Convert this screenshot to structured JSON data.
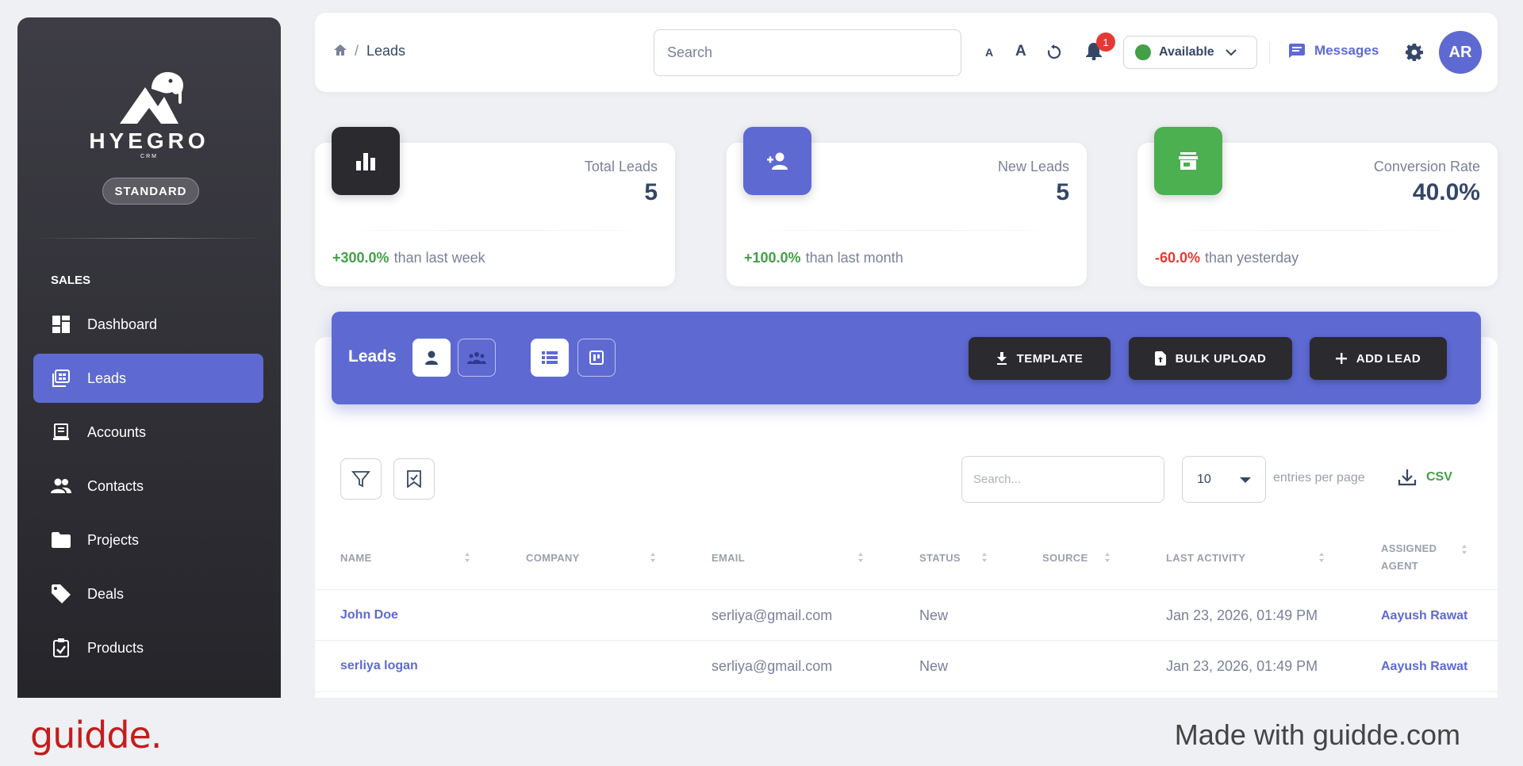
{
  "sidebar": {
    "brand_name": "HYEGRO",
    "brand_sub": "CRM",
    "plan": "STANDARD",
    "section": "SALES",
    "items": [
      {
        "label": "Dashboard",
        "icon": "dashboard-icon"
      },
      {
        "label": "Leads",
        "icon": "leads-icon",
        "active": true
      },
      {
        "label": "Accounts",
        "icon": "accounts-icon"
      },
      {
        "label": "Contacts",
        "icon": "contacts-icon"
      },
      {
        "label": "Projects",
        "icon": "folder-icon"
      },
      {
        "label": "Deals",
        "icon": "tag-icon"
      },
      {
        "label": "Products",
        "icon": "clipboard-icon"
      }
    ]
  },
  "topbar": {
    "breadcrumb_current": "Leads",
    "breadcrumb_sep": "/",
    "search_placeholder": "Search",
    "font_small": "A",
    "font_large": "A",
    "notification_count": "1",
    "status": "Available",
    "messages_label": "Messages",
    "avatar_initials": "AR"
  },
  "stats": [
    {
      "label": "Total Leads",
      "value": "5",
      "change": "+300.0%",
      "period": "than last week",
      "change_color": "#43a047",
      "icon": "bar-chart-icon",
      "icon_bg": "#2a2a2f"
    },
    {
      "label": "New Leads",
      "value": "5",
      "change": "+100.0%",
      "period": "than last month",
      "change_color": "#43a047",
      "icon": "person-add-icon",
      "icon_bg": "#5e6ad2"
    },
    {
      "label": "Conversion Rate",
      "value": "40.0%",
      "change": "-60.0%",
      "period": "than yesterday",
      "change_color": "#e53935",
      "icon": "store-icon",
      "icon_bg": "#4caf50"
    }
  ],
  "leads_panel": {
    "title": "Leads",
    "buttons": {
      "template": "TEMPLATE",
      "bulk_upload": "BULK UPLOAD",
      "add_lead": "ADD LEAD"
    },
    "table_search_placeholder": "Search...",
    "entries_value": "10",
    "entries_label": "entries per page",
    "csv_label": "CSV",
    "columns": [
      "NAME",
      "COMPANY",
      "EMAIL",
      "STATUS",
      "SOURCE",
      "LAST ACTIVITY",
      "ASSIGNED",
      "AGENT"
    ],
    "rows": [
      {
        "name": "John Doe",
        "company": "",
        "email": "serliya@gmail.com",
        "status": "New",
        "source": "",
        "last_activity": "Jan 23, 2026, 01:49 PM",
        "agent": "Aayush Rawat"
      },
      {
        "name": "serliya logan",
        "company": "",
        "email": "serliya@gmail.com",
        "status": "New",
        "source": "",
        "last_activity": "Jan 23, 2026, 01:49 PM",
        "agent": "Aayush Rawat"
      }
    ]
  },
  "footer": {
    "logo": "guidde.",
    "made_with": "Made with guidde.com"
  },
  "colors": {
    "accent": "#5e6ad2",
    "positive": "#43a047",
    "negative": "#e53935",
    "sidebar_dark": "#25252a"
  }
}
